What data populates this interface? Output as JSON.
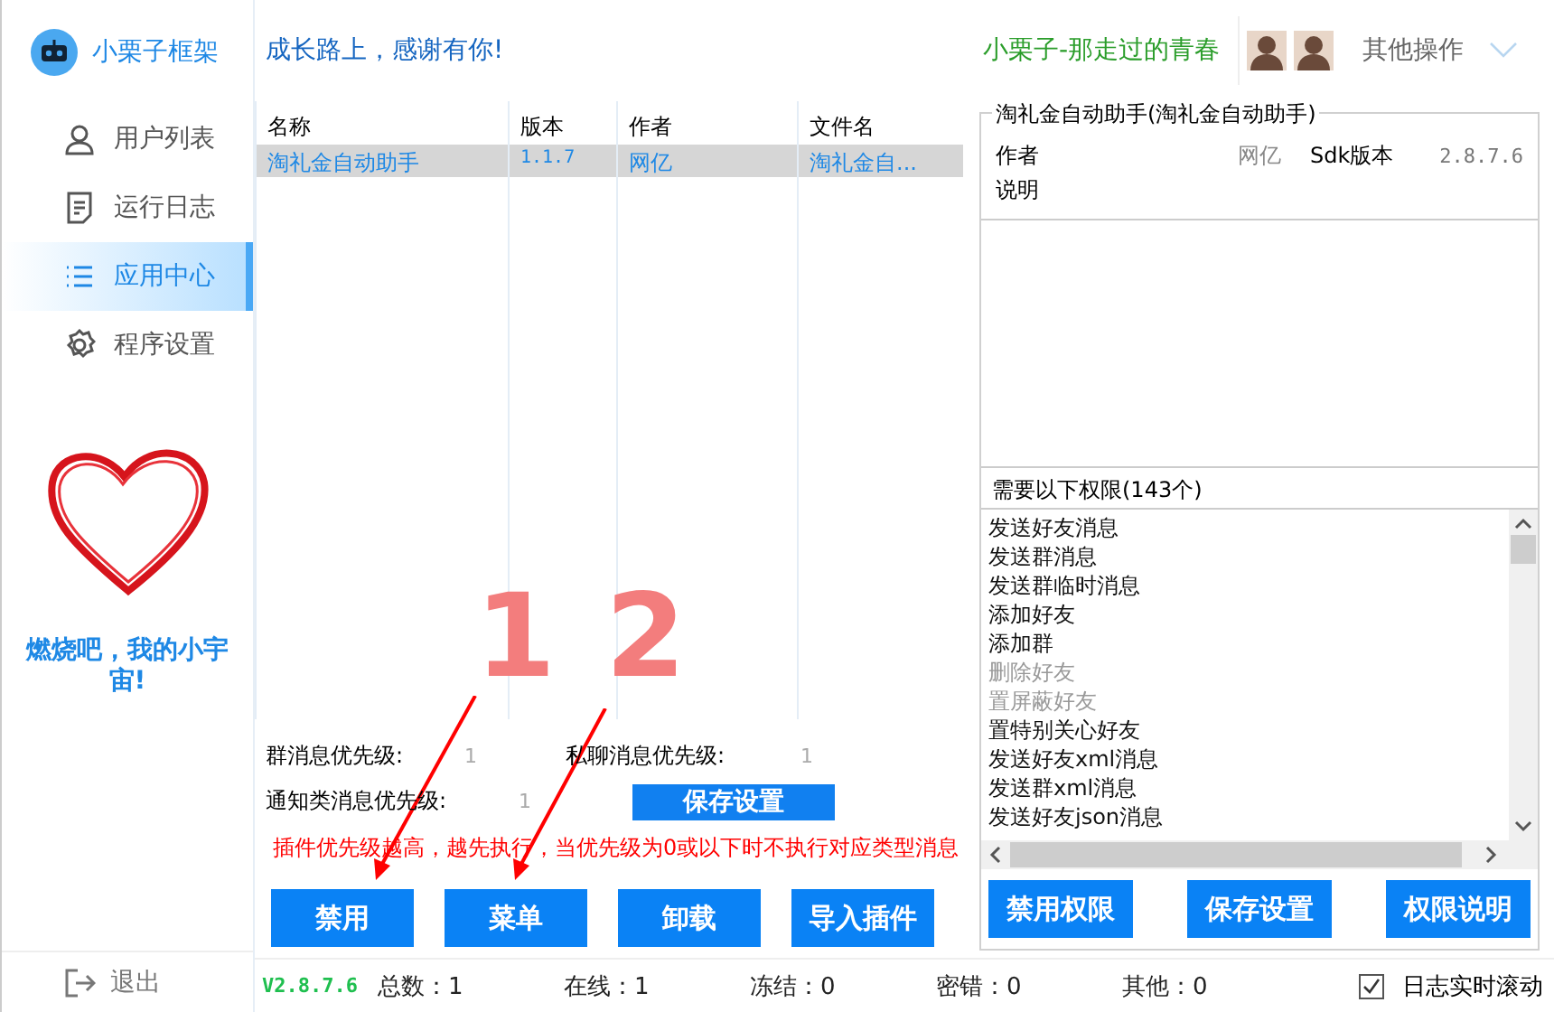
{
  "app": {
    "title": "小栗子框架"
  },
  "header": {
    "slogan": "成长路上，感谢有你!",
    "user": "小栗子-那走过的青春",
    "menu": "其他操作"
  },
  "sidebar": {
    "items": [
      {
        "label": "用户列表",
        "selected": false
      },
      {
        "label": "运行日志",
        "selected": false
      },
      {
        "label": "应用中心",
        "selected": true
      },
      {
        "label": "程序设置",
        "selected": false
      }
    ],
    "motto": "燃烧吧，我的小宇宙!",
    "logout": "退出"
  },
  "table": {
    "columns": [
      "名称",
      "版本",
      "作者",
      "文件名"
    ],
    "rows": [
      {
        "cells": [
          "淘礼金自动助手",
          "1.1.7",
          "网亿",
          "淘礼金自..."
        ],
        "selected": true
      }
    ]
  },
  "priorities": [
    {
      "label": "群消息优先级:",
      "value": "1"
    },
    {
      "label": "私聊消息优先级:",
      "value": "1"
    },
    {
      "label": "通知类消息优先级:",
      "value": "1"
    }
  ],
  "save_button": "保存设置",
  "notice": "插件优先级越高，越先执行，当优先级为0或以下时不执行对应类型消息",
  "plugin_buttons": [
    "禁用",
    "菜单",
    "卸载",
    "导入插件"
  ],
  "detail": {
    "title": "淘礼金自动助手(淘礼金自动助手)",
    "author_label": "作者",
    "author": "网亿",
    "sdk_label": "Sdk版本",
    "sdk": "2.8.7.6",
    "desc_label": "说明",
    "perm_title": "需要以下权限(143个)",
    "permissions": [
      {
        "label": "发送好友消息",
        "disabled": false
      },
      {
        "label": "发送群消息",
        "disabled": false
      },
      {
        "label": "发送群临时消息",
        "disabled": false
      },
      {
        "label": "添加好友",
        "disabled": false
      },
      {
        "label": "添加群",
        "disabled": false
      },
      {
        "label": "删除好友",
        "disabled": true
      },
      {
        "label": "置屏蔽好友",
        "disabled": true
      },
      {
        "label": "置特别关心好友",
        "disabled": false
      },
      {
        "label": "发送好友xml消息",
        "disabled": false
      },
      {
        "label": "发送群xml消息",
        "disabled": false
      },
      {
        "label": "发送好友json消息",
        "disabled": false
      }
    ],
    "buttons": [
      "禁用权限",
      "保存设置",
      "权限说明"
    ]
  },
  "status_bar": {
    "version": "V2.8.7.6",
    "stats": [
      "总数：1",
      "在线：1",
      "冻结：0",
      "密错：0",
      "其他：0"
    ],
    "autoscroll": {
      "label": "日志实时滚动",
      "checked": true
    }
  },
  "annotations": [
    {
      "label": "1"
    },
    {
      "label": "2"
    }
  ]
}
